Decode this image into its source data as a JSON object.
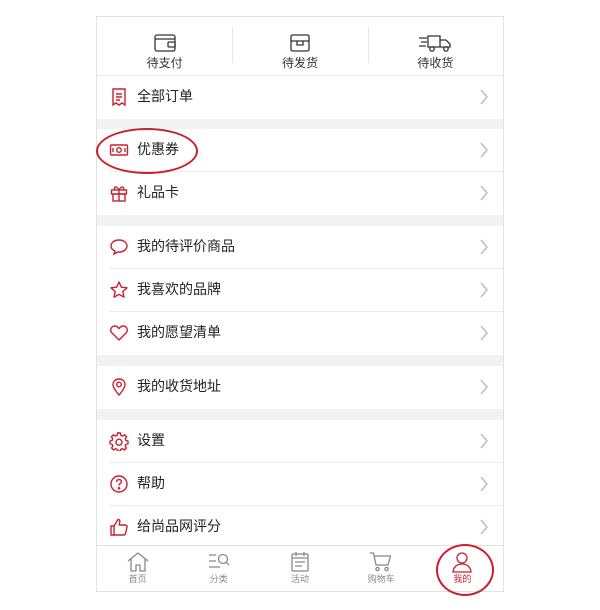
{
  "order_status": [
    {
      "label": "待支付",
      "icon": "wallet-icon"
    },
    {
      "label": "待发货",
      "icon": "package-icon"
    },
    {
      "label": "待收货",
      "icon": "delivery-truck-icon"
    }
  ],
  "menu": [
    {
      "label": "全部订单",
      "icon": "receipt-icon"
    },
    {
      "label": "优惠券",
      "icon": "coupon-icon"
    },
    {
      "label": "礼品卡",
      "icon": "gift-icon"
    },
    {
      "label": "我的待评价商品",
      "icon": "comment-icon"
    },
    {
      "label": "我喜欢的品牌",
      "icon": "star-icon"
    },
    {
      "label": "我的愿望清单",
      "icon": "heart-icon"
    },
    {
      "label": "我的收货地址",
      "icon": "location-pin-icon"
    },
    {
      "label": "设置",
      "icon": "gear-icon"
    },
    {
      "label": "帮助",
      "icon": "help-icon"
    },
    {
      "label": "给尚品网评分",
      "icon": "thumbs-up-icon"
    }
  ],
  "tabbar": [
    {
      "label": "首页",
      "icon": "home-icon"
    },
    {
      "label": "分类",
      "icon": "category-search-icon"
    },
    {
      "label": "活动",
      "icon": "calendar-icon"
    },
    {
      "label": "购物车",
      "icon": "cart-icon"
    },
    {
      "label": "我的",
      "icon": "user-icon",
      "active": true
    }
  ],
  "colors": {
    "accent": "#c9202f",
    "separator": "#f2f2f2",
    "inactive": "#888888"
  }
}
